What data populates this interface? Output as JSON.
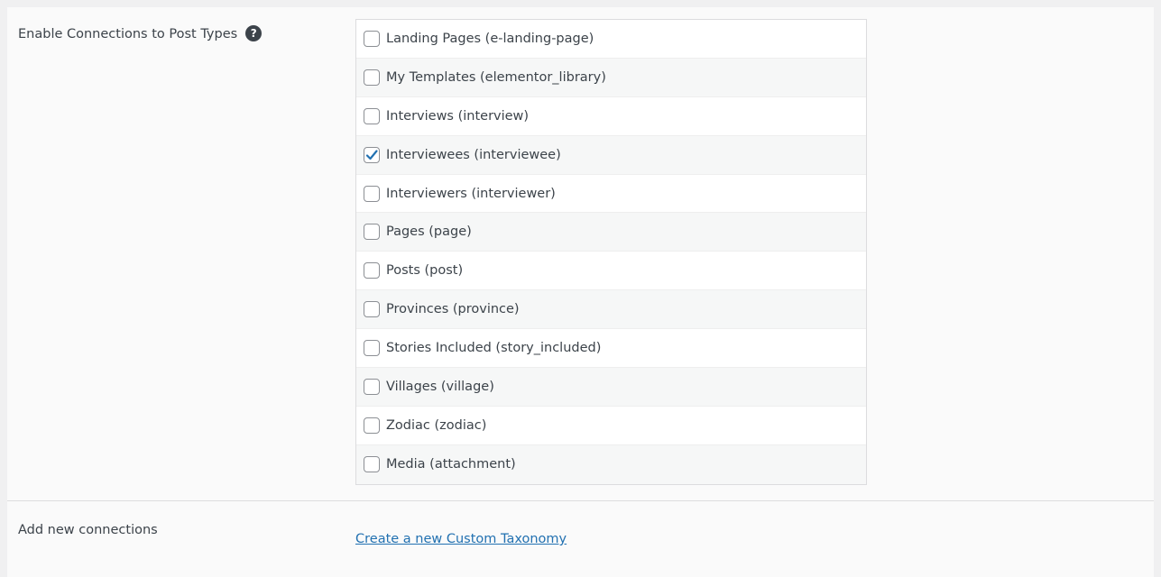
{
  "post_types_section": {
    "label": "Enable Connections to Post Types",
    "help_icon": "question-circle-icon",
    "help_glyph": "?",
    "items": [
      {
        "label": "Landing Pages (e-landing-page)",
        "checked": false
      },
      {
        "label": "My Templates (elementor_library)",
        "checked": false
      },
      {
        "label": "Interviews (interview)",
        "checked": false
      },
      {
        "label": "Interviewees (interviewee)",
        "checked": true
      },
      {
        "label": "Interviewers (interviewer)",
        "checked": false
      },
      {
        "label": "Pages (page)",
        "checked": false
      },
      {
        "label": "Posts (post)",
        "checked": false
      },
      {
        "label": "Provinces (province)",
        "checked": false
      },
      {
        "label": "Stories Included (story_included)",
        "checked": false
      },
      {
        "label": "Villages (village)",
        "checked": false
      },
      {
        "label": "Zodiac (zodiac)",
        "checked": false
      },
      {
        "label": "Media (attachment)",
        "checked": false
      }
    ]
  },
  "add_connections_section": {
    "label": "Add new connections",
    "link_text": "Create a new Custom Taxonomy"
  },
  "colors": {
    "link": "#2271b1",
    "checkmark": "#2271b1",
    "text": "#3c434a"
  }
}
